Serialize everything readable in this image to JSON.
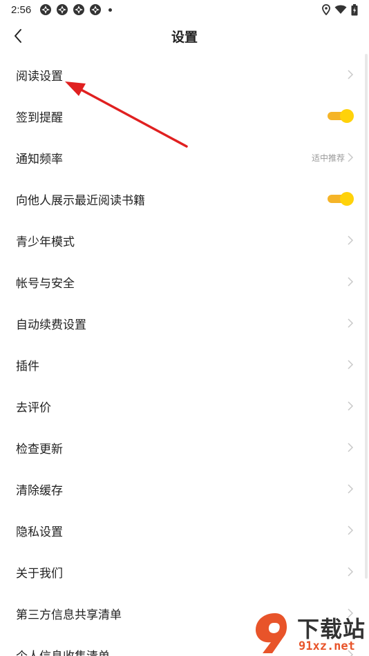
{
  "status_bar": {
    "time": "2:56"
  },
  "header": {
    "title": "设置"
  },
  "settings": [
    {
      "label": "阅读设置",
      "type": "link"
    },
    {
      "label": "签到提醒",
      "type": "toggle",
      "on": true
    },
    {
      "label": "通知频率",
      "type": "link",
      "value": "适中推荐"
    },
    {
      "label": "向他人展示最近阅读书籍",
      "type": "toggle",
      "on": true
    },
    {
      "label": "青少年模式",
      "type": "link"
    },
    {
      "label": "帐号与安全",
      "type": "link"
    },
    {
      "label": "自动续费设置",
      "type": "link"
    },
    {
      "label": "插件",
      "type": "link"
    },
    {
      "label": "去评价",
      "type": "link"
    },
    {
      "label": "检查更新",
      "type": "link"
    },
    {
      "label": "清除缓存",
      "type": "link"
    },
    {
      "label": "隐私设置",
      "type": "link"
    },
    {
      "label": "关于我们",
      "type": "link"
    },
    {
      "label": "第三方信息共享清单",
      "type": "link"
    },
    {
      "label": "个人信息收集清单",
      "type": "link"
    }
  ],
  "watermark": {
    "logo_text": "下载站",
    "domain": "91xz.net"
  },
  "colors": {
    "toggle_track": "#f5b428",
    "toggle_knob": "#ffd20a",
    "annotation_arrow": "#e02020",
    "chevron": "#c8c8c8"
  }
}
